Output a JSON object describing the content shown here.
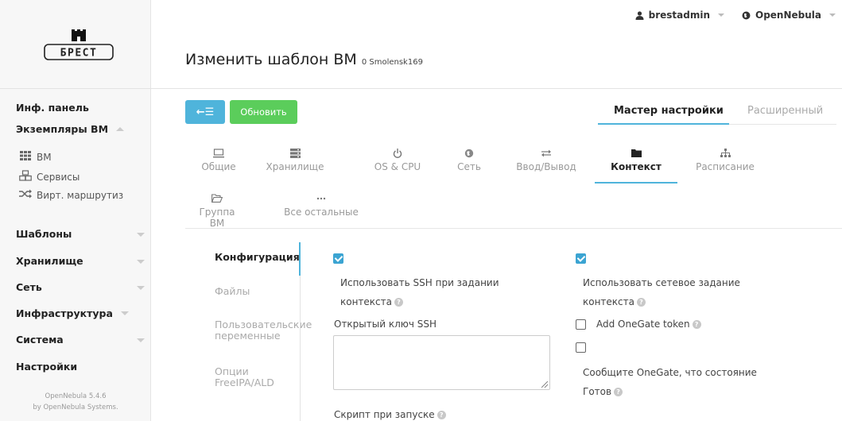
{
  "sidebar": {
    "logo_text": "БРЕСТ",
    "dashboard": "Инф. панель",
    "vm_instances": "Экземпляры ВМ",
    "vms": "ВМ",
    "services": "Сервисы",
    "virtual_routers": "Вирт. маршрутиз",
    "templates": "Шаблоны",
    "storage": "Хранилище",
    "network": "Сеть",
    "infrastructure": "Инфраструктура",
    "system": "Система",
    "settings": "Настройки",
    "version": "OpenNebula 5.4.6",
    "by": "by OpenNebula Systems."
  },
  "topbar": {
    "user": "brestadmin",
    "zone": "OpenNebula"
  },
  "header": {
    "title": "Изменить шаблон ВМ",
    "subtitle": "0 Smolensk169"
  },
  "toolbar": {
    "back_label": "←☰",
    "refresh_label": "Обновить",
    "wizard_label": "Мастер настройки",
    "advanced_label": "Расширенный"
  },
  "section_tabs": [
    {
      "label": "Общие",
      "icon": "monitor-icon"
    },
    {
      "label": "Хранилище",
      "icon": "storage-icon"
    },
    {
      "label": "OS & CPU",
      "icon": "power-icon"
    },
    {
      "label": "Сеть",
      "icon": "globe-icon"
    },
    {
      "label": "Ввод/Вывод",
      "icon": "exchange-icon"
    },
    {
      "label": "Контекст",
      "icon": "folder-icon"
    },
    {
      "label": "Расписание",
      "icon": "sitemap-icon"
    },
    {
      "label": "Группа ВМ",
      "icon": "folder-open-icon"
    },
    {
      "label": "Все остальные",
      "icon": "ellipsis-icon"
    }
  ],
  "context_nav": {
    "configuration": "Конфигурация",
    "files": "Файлы",
    "custom_vars_1": "Пользовательские",
    "custom_vars_2": "переменные",
    "freeipa_1": "Опции",
    "freeipa_2": "FreeIPA/ALD"
  },
  "form": {
    "ssh_context_1": "Использовать SSH при задании",
    "ssh_context_2": "контекста",
    "ssh_key_label": "Открытый ключ SSH",
    "start_script_label": "Скрипт при запуске",
    "network_context_1": "Использовать сетевое задание",
    "network_context_2": "контекста",
    "onegate_token": "Add OneGate token",
    "report_ready_1": "Сообщите OneGate, что состояние",
    "report_ready_2": "Готов",
    "ssh_context_checked": true,
    "network_context_checked": true,
    "onegate_token_checked": false,
    "report_ready_checked": false
  },
  "colors": {
    "accent": "#4fb4db",
    "success": "#5bcd5b",
    "checkbox": "#3ba4d2"
  }
}
